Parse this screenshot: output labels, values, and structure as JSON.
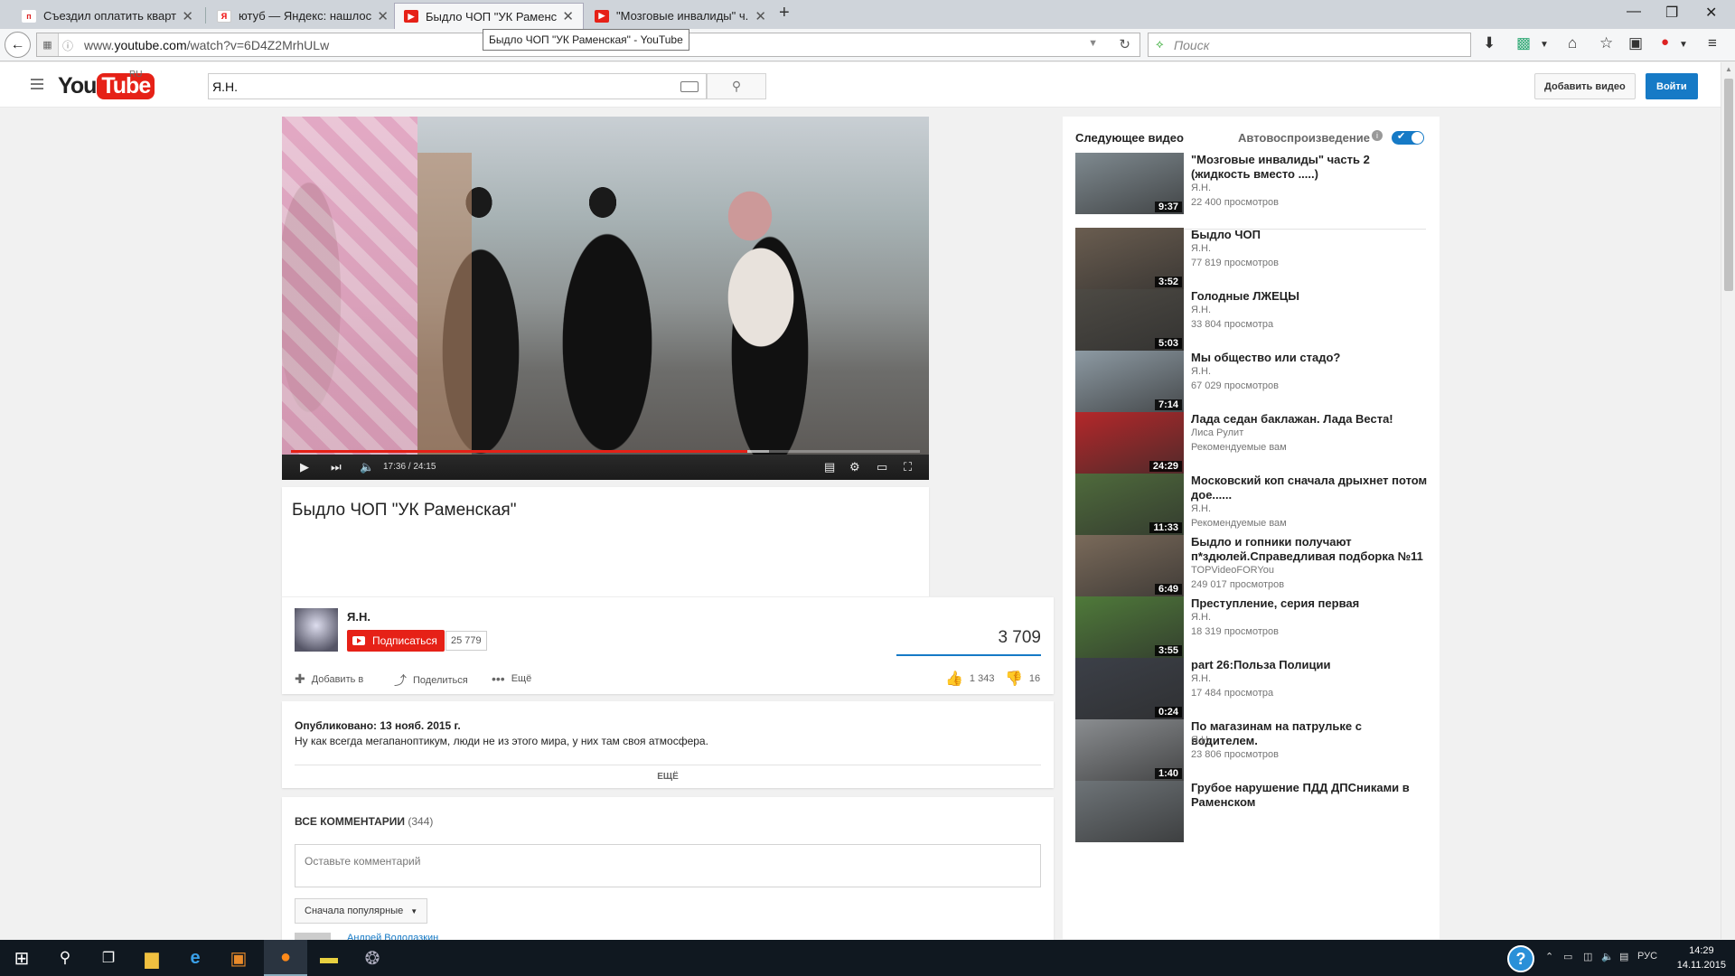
{
  "browser": {
    "tabs": [
      {
        "title": "Съездил оплатить кварти...",
        "color": "#d22"
      },
      {
        "title": "ютуб — Яндекс: нашлос...",
        "color": "#fff"
      },
      {
        "title": "Быдло ЧОП \"УК Раменск...",
        "color": "#e62117"
      },
      {
        "title": "\"Мозговые инвалиды\" ч...",
        "color": "#e62117"
      }
    ],
    "url_prefix": "www.",
    "url_domain": "youtube.com",
    "url_path": "/watch?v=6D4Z2MrhULw",
    "tooltip": "Быдло ЧОП \"УК Раменская\" - YouTube",
    "search_placeholder": "Поиск"
  },
  "header": {
    "logo_you": "You",
    "logo_tube": "Tube",
    "region": "RU",
    "search_value": "Я.Н.",
    "upload_label": "Добавить видео",
    "login_label": "Войти"
  },
  "player": {
    "time": "17:36 / 24:15",
    "played_fraction": 0.726,
    "buffered_fraction": 0.76
  },
  "video": {
    "title": "Быдло ЧОП \"УК Раменская\"",
    "owner": "Я.Н.",
    "subscribe_label": "Подписаться",
    "subscriber_count": "25 779",
    "views": "3 709",
    "add_label": "Добавить в",
    "share_label": "Поделиться",
    "more_label": "Ещё",
    "likes": "1 343",
    "dislikes": "16",
    "published": "Опубликовано: 13 нояб. 2015 г.",
    "description": "Ну как всегда мегапаноптикум, люди не из этого мира, у них там своя атмосфера.",
    "show_more": "ЕЩЁ"
  },
  "comments": {
    "title": "ВСЕ КОММЕНТАРИИ",
    "count": "(344)",
    "placeholder": "Оставьте комментарий",
    "sort_label": "Сначала популярные",
    "next_author": "Андрей Водолазкин"
  },
  "sidebar": {
    "up_next": "Следующее видео",
    "autoplay": "Автовоспроизведение",
    "videos": [
      {
        "title": "\"Мозговые инвалиды\" часть 2 (жидкость вместо .....)",
        "author": "Я.Н.",
        "meta": "22 400 просмотров",
        "duration": "9:37",
        "bg": "#7f8a90"
      },
      {
        "title": "Быдло ЧОП",
        "author": "Я.Н.",
        "meta": "77 819 просмотров",
        "duration": "3:52",
        "bg": "#6a5d50"
      },
      {
        "title": "Голодные ЛЖЕЦЫ",
        "author": "Я.Н.",
        "meta": "33 804 просмотра",
        "duration": "5:03",
        "bg": "#4d4a44"
      },
      {
        "title": "Мы общество или стадо?",
        "author": "Я.Н.",
        "meta": "67 029 просмотров",
        "duration": "7:14",
        "bg": "#8d9aa3"
      },
      {
        "title": "Лада седан баклажан. Лада Веста!",
        "author": "Лиса Рулит",
        "meta": "Рекомендуемые вам",
        "duration": "24:29",
        "bg": "#b4282a"
      },
      {
        "title": "Московский коп сначала дрыхнет потом дое......",
        "author": "Я.Н.",
        "meta": "Рекомендуемые вам",
        "duration": "11:33",
        "bg": "#4f6b3c"
      },
      {
        "title": "Быдло и гопники получают п*здюлей.Справедливая подборка №11",
        "author": "TOPVideoFORYou",
        "meta": "249 017 просмотров",
        "duration": "6:49",
        "bg": "#7a6a5a"
      },
      {
        "title": "Преступление, серия первая",
        "author": "Я.Н.",
        "meta": "18 319 просмотров",
        "duration": "3:55",
        "bg": "#4f7a3a"
      },
      {
        "title": "part 26:Польза Полиции",
        "author": "Я.Н.",
        "meta": "17 484 просмотра",
        "duration": "0:24",
        "bg": "#3c4048"
      },
      {
        "title": "По магазинам на патрульке с водителем.",
        "author": "Я.Н.",
        "meta": "23 806 просмотров",
        "duration": "1:40",
        "bg": "#8a8d90"
      },
      {
        "title": "Грубое нарушение ПДД ДПСниками в Раменском",
        "author": "",
        "meta": "",
        "duration": "",
        "bg": "#6e7478"
      }
    ]
  },
  "taskbar": {
    "lang": "РУС",
    "time": "14:29",
    "date": "14.11.2015"
  }
}
